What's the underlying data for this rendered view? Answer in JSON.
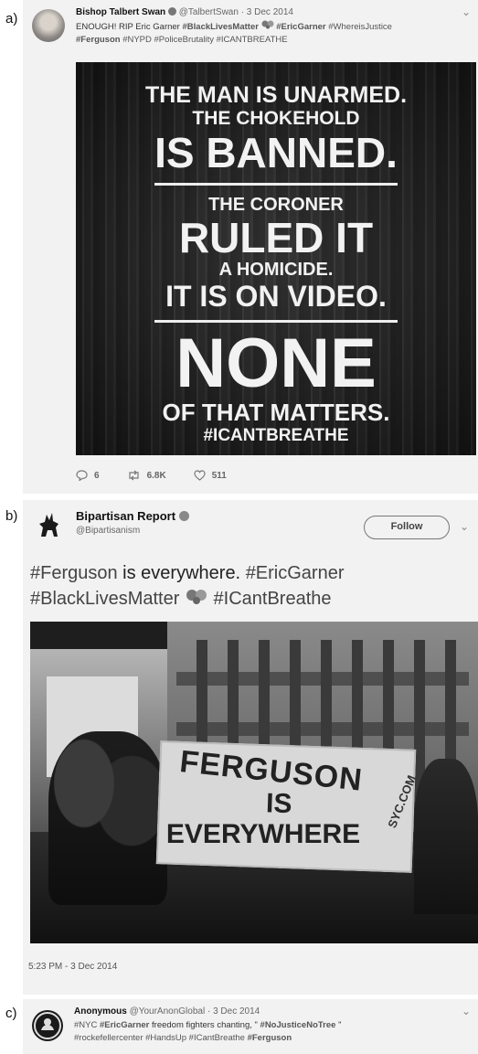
{
  "panels": {
    "a_letter": "a)",
    "b_letter": "b)",
    "c_letter": "c)"
  },
  "tweet_a": {
    "author": "Bishop Talbert Swan",
    "handle_date": "@TalbertSwan · 3 Dec 2014",
    "line1_prefix": "ENOUGH! RIP Eric Garner ",
    "line1_tag1": "#BlackLivesMatter",
    "line1_tag2": "#EricGarner",
    "line1_tag3": "#WhereisJustice",
    "line2_tag_bold": "#Ferguson",
    "line2_rest": "#NYPD #PoliceBrutality #ICANTBREATHE",
    "image_text": {
      "l1": "THE MAN IS UNARMED.",
      "l2": "THE CHOKEHOLD",
      "l3": "IS BANNED.",
      "l4": "THE CORONER",
      "l5": "RULED IT",
      "l6": "A HOMICIDE.",
      "l7": "IT IS ON VIDEO.",
      "l8": "NONE",
      "l9": "OF THAT MATTERS.",
      "l10": "#ICANTBREATHE"
    },
    "stats": {
      "replies": "6",
      "retweets": "6.8K",
      "likes": "511"
    }
  },
  "tweet_b": {
    "author": "Bipartisan Report",
    "handle": "@Bipartisanism",
    "follow_label": "Follow",
    "text_l1_tag1": "#Ferguson",
    "text_l1_mid": " is everywhere. ",
    "text_l1_tag2": "#EricGarner",
    "text_l2_tag1": "#BlackLivesMatter",
    "text_l2_tag2": "#ICantBreathe",
    "banner_l1": "FERGUSON",
    "banner_l2": "IS",
    "banner_l3": "EVERYWHERE",
    "banner_side": "SYC.COM",
    "timestamp": "5:23 PM - 3 Dec 2014"
  },
  "tweet_c": {
    "author": "Anonymous",
    "handle_date": "@YourAnonGlobal · 3 Dec 2014",
    "line1_a": "#NYC ",
    "line1_b": "#EricGarner",
    "line1_c": " freedom fighters chanting, \" ",
    "line1_d": "#NoJusticeNoTree",
    "line1_e": " \"",
    "line2_rest": "#rockefellercenter #HandsUp #ICantBreathe ",
    "line2_bold": "#Ferguson"
  },
  "colors": {
    "card_bg": "#f2f2f2",
    "text": "#111111",
    "muted": "#666666",
    "image_dark": "#2a2a2a"
  },
  "icons": [
    "verified-badge-icon",
    "reply-icon",
    "retweet-icon",
    "like-icon",
    "chevron-down-icon",
    "follow-button"
  ]
}
